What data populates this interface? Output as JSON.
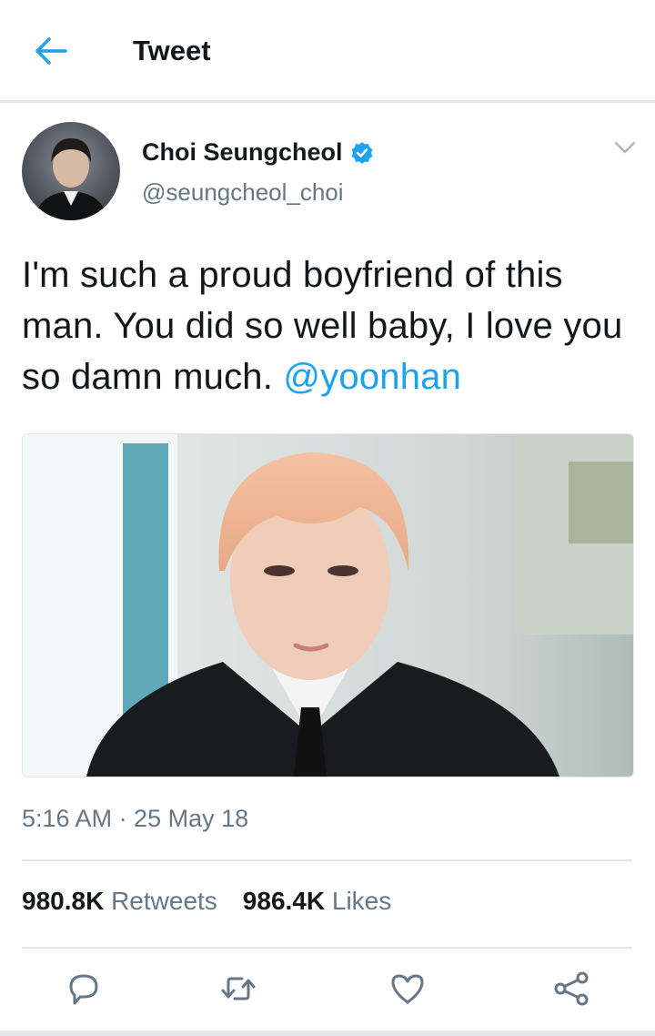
{
  "header": {
    "title": "Tweet",
    "back_icon": "arrow-left-icon"
  },
  "author": {
    "name": "Choi Seungcheol",
    "handle": "@seungcheol_choi",
    "verified": true,
    "verified_icon": "verified-badge-icon"
  },
  "tweet": {
    "text": "I'm such a proud boyfriend of this man. You did so well baby, I love you so damn much. ",
    "mention": "@yoonhan",
    "timestamp": "5:16 AM · 25 May 18"
  },
  "stats": {
    "retweets_count": "980.8K",
    "retweets_label": "Retweets",
    "likes_count": "986.4K",
    "likes_label": "Likes"
  },
  "actions": [
    "reply-icon",
    "retweet-icon",
    "like-icon",
    "share-icon"
  ],
  "colors": {
    "accent": "#1da1f2",
    "text": "#14171a",
    "secondary": "#657786",
    "border": "#e1e8ed"
  }
}
